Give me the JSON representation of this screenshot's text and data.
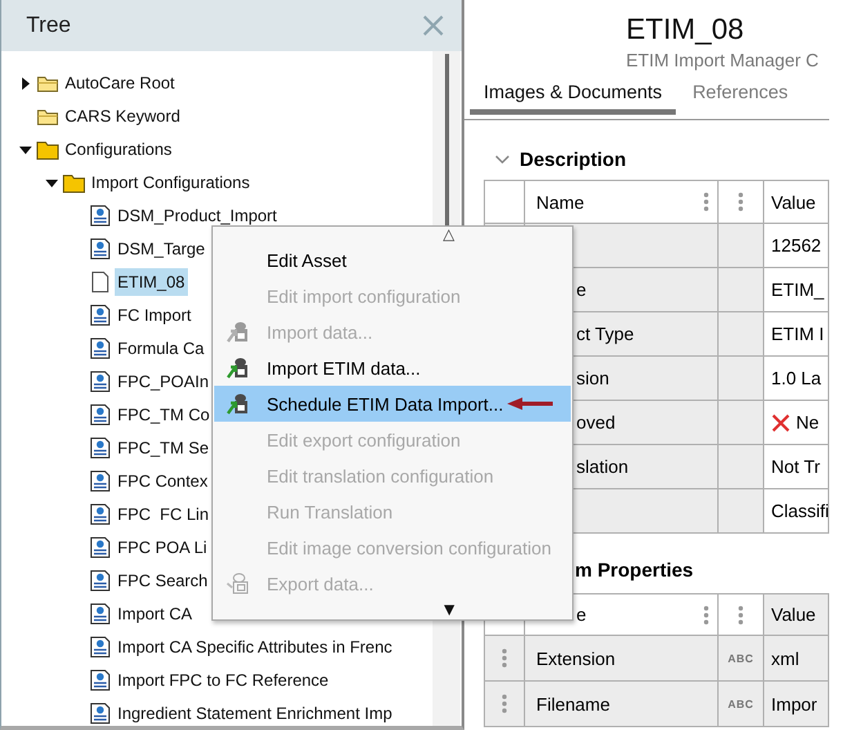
{
  "tree_panel": {
    "title": "Tree",
    "items": [
      {
        "label": "AutoCare Root",
        "kind": "light-folder",
        "expanded": false,
        "selected": false
      },
      {
        "label": "CARS Keyword",
        "kind": "light-folder",
        "selected": false
      },
      {
        "label": "Configurations",
        "kind": "folder",
        "expanded": true,
        "selected": false,
        "children": [
          {
            "label": "Import Configurations",
            "kind": "folder",
            "expanded": true,
            "selected": false,
            "children": [
              {
                "label": "DSM_Product_Import",
                "kind": "config",
                "selected": false
              },
              {
                "label": "DSM_Targe",
                "kind": "config",
                "selected": false
              },
              {
                "label": "ETIM_08",
                "kind": "file",
                "selected": true
              },
              {
                "label": "FC Import",
                "kind": "config",
                "selected": false
              },
              {
                "label": "Formula Ca",
                "kind": "config",
                "selected": false
              },
              {
                "label": "FPC_POAIn",
                "kind": "config",
                "selected": false
              },
              {
                "label": "FPC_TM Co",
                "kind": "config",
                "selected": false
              },
              {
                "label": "FPC_TM Se",
                "kind": "config",
                "selected": false
              },
              {
                "label": "FPC Contex",
                "kind": "config",
                "selected": false
              },
              {
                "label": "FPC  FC Lin",
                "kind": "config",
                "selected": false
              },
              {
                "label": "FPC POA Li",
                "kind": "config",
                "selected": false
              },
              {
                "label": "FPC Search",
                "kind": "config",
                "selected": false
              },
              {
                "label": "Import CA",
                "kind": "config",
                "selected": false
              },
              {
                "label": "Import CA Specific Attributes in Frenc",
                "kind": "config",
                "selected": false
              },
              {
                "label": "Import FPC to FC Reference",
                "kind": "config",
                "selected": false
              },
              {
                "label": "Ingredient Statement Enrichment Imp",
                "kind": "config",
                "selected": false
              }
            ]
          }
        ]
      }
    ]
  },
  "context_menu": {
    "scroll_up": "△",
    "items": [
      {
        "label": "Edit Asset",
        "kind": "plain",
        "disabled": false,
        "selected": false,
        "marked": false
      },
      {
        "label": "Edit import configuration",
        "kind": "plain",
        "disabled": true,
        "selected": false,
        "marked": false
      },
      {
        "label": "Import data...",
        "kind": "import",
        "disabled": true,
        "selected": false,
        "marked": false
      },
      {
        "label": "Import ETIM data...",
        "kind": "import",
        "disabled": false,
        "selected": false,
        "marked": false
      },
      {
        "label": "Schedule ETIM Data Import...",
        "kind": "import",
        "disabled": false,
        "selected": true,
        "marked": true
      },
      {
        "label": "Edit export configuration",
        "kind": "plain",
        "disabled": true,
        "selected": false,
        "marked": false
      },
      {
        "label": "Edit translation configuration",
        "kind": "plain",
        "disabled": true,
        "selected": false,
        "marked": false
      },
      {
        "label": "Run Translation",
        "kind": "plain",
        "disabled": true,
        "selected": false,
        "marked": false
      },
      {
        "label": "Edit image conversion configuration",
        "kind": "plain",
        "disabled": true,
        "selected": false,
        "marked": false
      },
      {
        "label": "Export data...",
        "kind": "export",
        "disabled": true,
        "selected": false,
        "marked": false
      }
    ],
    "scroll_down": "▼"
  },
  "asset": {
    "title": "ETIM_08",
    "subtitle": "ETIM Import Manager C"
  },
  "tabs": [
    {
      "label": "Images & Documents",
      "selected": true
    },
    {
      "label": "References",
      "selected": false
    }
  ],
  "sections": [
    {
      "title": "Description",
      "expanded": true,
      "header": {
        "name": "Name",
        "value": "Value"
      },
      "rows": [
        {
          "kind": "plain",
          "value": "12562"
        },
        {
          "kind": "plain",
          "name": "e",
          "value": "ETIM_"
        },
        {
          "kind": "plain",
          "name": "ct Type",
          "value": "ETIM I"
        },
        {
          "kind": "plain",
          "name": "sion",
          "value": "1.0 La"
        },
        {
          "kind": "cross",
          "name": "oved",
          "value": "Ne"
        },
        {
          "kind": "plain",
          "name": "slation",
          "value": "Not Tr"
        },
        {
          "kind": "plain",
          "value": "Classifi"
        }
      ]
    },
    {
      "title": "m Properties",
      "header": {
        "name": "e",
        "value": "Value"
      },
      "rows": [
        {
          "kind": "plain",
          "name": "Extension",
          "type": "ABC",
          "value": "xml",
          "handle": true
        },
        {
          "kind": "plain",
          "name": "Filename",
          "type": "ABC",
          "value": "Impor",
          "handle": true
        }
      ]
    }
  ]
}
